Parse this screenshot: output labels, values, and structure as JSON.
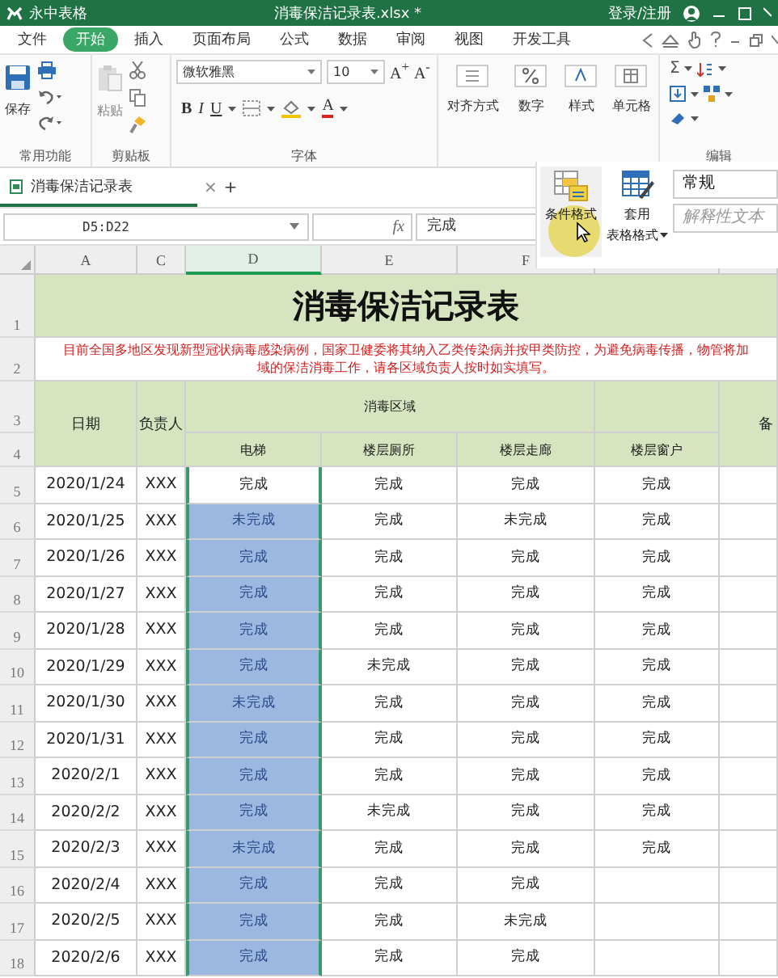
{
  "app": {
    "name": "永中表格",
    "doc_title": "消毒保洁记录表.xlsx *",
    "account": "登录/注册"
  },
  "menu_tabs": [
    {
      "label": "文件",
      "selected": false
    },
    {
      "label": "开始",
      "selected": true
    },
    {
      "label": "插入",
      "selected": false
    },
    {
      "label": "页面布局",
      "selected": false
    },
    {
      "label": "公式",
      "selected": false
    },
    {
      "label": "数据",
      "selected": false
    },
    {
      "label": "审阅",
      "selected": false
    },
    {
      "label": "视图",
      "selected": false
    },
    {
      "label": "开发工具",
      "selected": false
    }
  ],
  "ribbon": {
    "save": "保存",
    "paste": "粘贴",
    "font_name": "微软雅黑",
    "font_size": "10",
    "font_grow": "A$^{+}$",
    "font_shrink": "A$^{-}$",
    "bold": "B",
    "italic": "I",
    "underline": "U",
    "font_color": "A",
    "align": "对齐方式",
    "number": "数字",
    "style": "样式",
    "cells": "单元格",
    "sum": "Σ",
    "groups": [
      {
        "label": "常用功能"
      },
      {
        "label": "剪贴板"
      },
      {
        "label": "字体"
      },
      {
        "label": "编辑"
      }
    ]
  },
  "doc_tab": {
    "label": "消毒保洁记录表",
    "close": "×",
    "add": "+"
  },
  "formula_bar": {
    "name_box": "D5:D22",
    "fx": "fx",
    "value": "完成"
  },
  "popup": {
    "conditional_format": "条件格式",
    "table_format_1": "套用",
    "table_format_2": "表格格式",
    "number_format": "常规",
    "style_sample": "解释性文本"
  },
  "header_row_numbers": [
    "1",
    "2",
    "3",
    "4"
  ],
  "columns": [
    {
      "label": "A",
      "selected": false
    },
    {
      "label": "C",
      "selected": false
    },
    {
      "label": "D",
      "selected": true
    },
    {
      "label": "E",
      "selected": false
    },
    {
      "label": "F",
      "selected": false
    }
  ],
  "sheet": {
    "title": "消毒保洁记录表",
    "notice": [
      "目前全国多地区发现新型冠状病毒感染病例，国家卫健委将其纳入乙类传染病并按甲类防控，为避免病毒传播，物管将加",
      "域的保洁消毒工作，请各区域负责人按时如实填写。"
    ],
    "date": "日期",
    "person": "负责人",
    "area": "消毒区域",
    "areas": [
      "电梯",
      "楼层厕所",
      "楼层走廊",
      "楼层窗户"
    ],
    "remark": "备"
  },
  "rows": [
    {
      "n": "5",
      "date": "2020/1/24",
      "person": "XXX",
      "elevator": {
        "text": "完成",
        "selected": true,
        "active": true
      },
      "others": [
        "完成",
        "完成",
        "完成"
      ]
    },
    {
      "n": "6",
      "date": "2020/1/25",
      "person": "XXX",
      "elevator": {
        "text": "未完成",
        "selected": true,
        "active": false
      },
      "others": [
        "完成",
        "未完成",
        "完成"
      ]
    },
    {
      "n": "7",
      "date": "2020/1/26",
      "person": "XXX",
      "elevator": {
        "text": "完成",
        "selected": true,
        "active": false
      },
      "others": [
        "完成",
        "完成",
        "完成"
      ]
    },
    {
      "n": "8",
      "date": "2020/1/27",
      "person": "XXX",
      "elevator": {
        "text": "完成",
        "selected": true,
        "active": false
      },
      "others": [
        "完成",
        "完成",
        "完成"
      ]
    },
    {
      "n": "9",
      "date": "2020/1/28",
      "person": "XXX",
      "elevator": {
        "text": "完成",
        "selected": true,
        "active": false
      },
      "others": [
        "完成",
        "完成",
        "完成"
      ]
    },
    {
      "n": "10",
      "date": "2020/1/29",
      "person": "XXX",
      "elevator": {
        "text": "完成",
        "selected": true,
        "active": false
      },
      "others": [
        "未完成",
        "完成",
        "完成"
      ]
    },
    {
      "n": "11",
      "date": "2020/1/30",
      "person": "XXX",
      "elevator": {
        "text": "未完成",
        "selected": true,
        "active": false
      },
      "others": [
        "完成",
        "完成",
        "完成"
      ]
    },
    {
      "n": "12",
      "date": "2020/1/31",
      "person": "XXX",
      "elevator": {
        "text": "完成",
        "selected": true,
        "active": false
      },
      "others": [
        "完成",
        "完成",
        "完成"
      ]
    },
    {
      "n": "13",
      "date": "2020/2/1",
      "person": "XXX",
      "elevator": {
        "text": "完成",
        "selected": true,
        "active": false
      },
      "others": [
        "完成",
        "完成",
        "完成"
      ]
    },
    {
      "n": "14",
      "date": "2020/2/2",
      "person": "XXX",
      "elevator": {
        "text": "完成",
        "selected": true,
        "active": false
      },
      "others": [
        "未完成",
        "完成",
        "完成"
      ]
    },
    {
      "n": "15",
      "date": "2020/2/3",
      "person": "XXX",
      "elevator": {
        "text": "未完成",
        "selected": true,
        "active": false
      },
      "others": [
        "完成",
        "完成",
        "完成"
      ]
    },
    {
      "n": "16",
      "date": "2020/2/4",
      "person": "XXX",
      "elevator": {
        "text": "完成",
        "selected": true,
        "active": false
      },
      "others": [
        "完成",
        "完成"
      ]
    },
    {
      "n": "17",
      "date": "2020/2/5",
      "person": "XXX",
      "elevator": {
        "text": "完成",
        "selected": true,
        "active": false
      },
      "others": [
        "完成",
        "未完成"
      ]
    },
    {
      "n": "18",
      "date": "2020/2/6",
      "person": "XXX",
      "elevator": {
        "text": "完成",
        "selected": true,
        "active": false
      },
      "others": [
        "完成",
        "完成"
      ]
    }
  ]
}
